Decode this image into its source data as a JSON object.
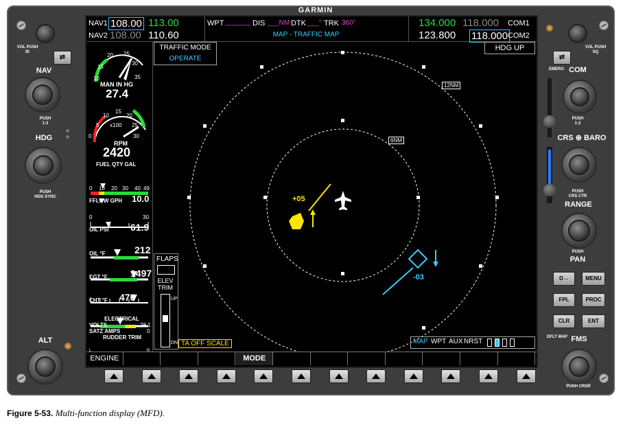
{
  "brand": "GARMIN",
  "left_panel": {
    "vol_push_id": "VOL PUSH ID",
    "swap": "⇄",
    "nav": "NAV",
    "push_1_2": "PUSH\n1-2",
    "hdg": "HDG",
    "push_hdg_sync": "PUSH\nHDG SYNC",
    "alt": "ALT"
  },
  "right_panel": {
    "vol_push_sq": "VOL PUSH SQ",
    "emerg": "EMERG",
    "com": "COM",
    "push_1_2": "PUSH\n1-2",
    "crs_baro": "CRS ⊕ BARO",
    "push_crs_ctr": "PUSH\nCRS CTR",
    "range": "RANGE",
    "push_pan": "PUSH",
    "pan": "PAN",
    "direct_to": "D→",
    "menu": "MENU",
    "fpl": "FPL",
    "proc": "PROC",
    "clr": "CLR",
    "ent": "ENT",
    "dflt_map": "DFLT MAP",
    "fms": "FMS",
    "push_crsr": "PUSH CRSR"
  },
  "top_bar": {
    "nav1_label": "NAV1",
    "nav1_active": "108.00",
    "nav1_standby": "113.00",
    "nav2_label": "NAV2",
    "nav2_active": "108.00",
    "nav2_standby": "110.60",
    "wpt_label": "WPT",
    "wpt_value": "______",
    "dis_label": "DIS",
    "dis_value": "___NM",
    "dtk_label": "DTK",
    "dtk_value": "___°",
    "trk_label": "TRK",
    "trk_value": "360°",
    "page_title": "MAP - TRAFFIC MAP",
    "com1_active": "134.000",
    "com1_standby": "118.000",
    "com1_label": "COM1",
    "com2_active": "123.800",
    "com2_standby": "118.000",
    "com2_label": "COM2"
  },
  "eis": {
    "manifold_ticks": [
      "10",
      "15",
      "20",
      "25",
      "30",
      "35"
    ],
    "man_in_hg_label": "MAN IN HG",
    "man_in_hg_value": "27.4",
    "rpm_ticks": [
      "0",
      "5",
      "10",
      "15",
      "20",
      "25",
      "30"
    ],
    "rpm_scale": "x100",
    "rpm_label": "RPM",
    "rpm_value": "2420",
    "fuel_qty_label": "FUEL QTY GAL",
    "fuel_ticks": [
      "0",
      "10",
      "20",
      "30",
      "40",
      "49"
    ],
    "fuel_marker_r": "R",
    "fuel_marker_l": "L",
    "fflow_label": "FFLOW GPH",
    "fflow_value": "10.0",
    "fflow_min": "0",
    "fflow_max": "30",
    "oil_psi_label": "OIL PSI",
    "oil_psi_value": "61.9",
    "oil_f_label": "OIL °F",
    "oil_f_value": "212",
    "egt_label": "EGT °F",
    "egt_value": "1497",
    "cht_label": "CHT °F",
    "cht_value": "476",
    "electrical_label": "ELECTRICAL",
    "volts_label": "VOLTS",
    "volts_value": "28.1",
    "satz_amps_label": "SATZ AMPS",
    "satz_amps_value": "0",
    "rudder_trim_label": "RUDDER TRIM",
    "rudder_l": "L",
    "rudder_r": "R"
  },
  "flaps_panel": {
    "flaps_label": "FLAPS",
    "elev_trim_label": "ELEV TRIM",
    "up_label": "UP",
    "dn_label": "DN"
  },
  "traffic_map": {
    "traffic_mode_label": "TRAFFIC MODE",
    "operate_label": "OPERATE",
    "orientation": "HDG UP",
    "range_outer": "12NM",
    "range_inner": "6NM",
    "target1_alt": "+05",
    "target2_alt": "-03",
    "ta_off_scale": "TA OFF SCALE",
    "page_groups": [
      "MAP",
      "WPT",
      "AUX",
      "NRST"
    ]
  },
  "softkeys": [
    "ENGINE",
    "",
    "",
    "",
    "MODE",
    "",
    "",
    "",
    "",
    "",
    "",
    ""
  ],
  "caption": {
    "figure": "Figure 5-53.",
    "text": "Multi-function display (MFD)."
  },
  "colors": {
    "bezel": "#3d3d3d",
    "screen": "#000000",
    "active_green": "#2bd83c",
    "cyan": "#3ec8ff",
    "magenta": "#e040d0",
    "traffic_yellow": "#ffe400"
  }
}
